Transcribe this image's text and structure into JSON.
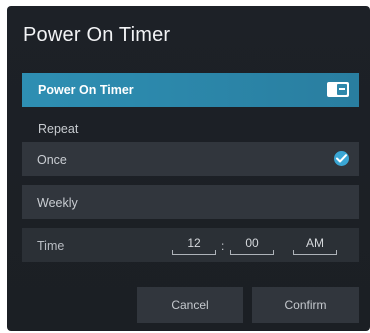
{
  "dialog": {
    "title": "Power On Timer",
    "toggle_row": {
      "label": "Power On Timer",
      "enabled": true
    },
    "repeat_section": {
      "label": "Repeat"
    },
    "options": [
      {
        "label": "Once",
        "selected": true
      },
      {
        "label": "Weekly",
        "selected": false
      }
    ],
    "time": {
      "label": "Time",
      "hour": "12",
      "separator": ":",
      "minute": "00",
      "period": "AM"
    },
    "buttons": {
      "cancel": "Cancel",
      "confirm": "Confirm"
    }
  },
  "colors": {
    "background": "#1d2127",
    "accent": "#2e8fb3",
    "option_bg": "#31363d",
    "check": "#3aa6d4"
  },
  "icons": [
    "toggle-icon",
    "check-icon"
  ]
}
